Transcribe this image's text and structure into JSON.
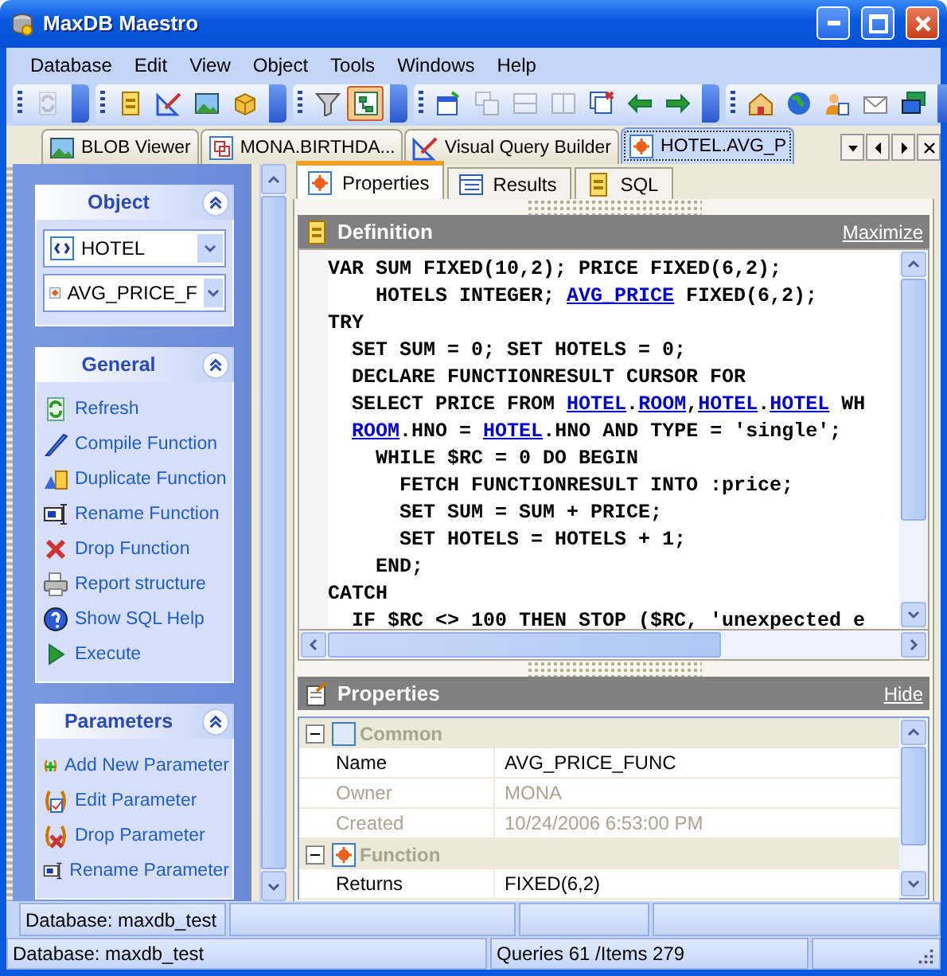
{
  "window": {
    "title": "MaxDB Maestro"
  },
  "menu": [
    {
      "label": "Database"
    },
    {
      "label": "Edit"
    },
    {
      "label": "View"
    },
    {
      "label": "Object"
    },
    {
      "label": "Tools"
    },
    {
      "label": "Windows"
    },
    {
      "label": "Help"
    }
  ],
  "toolbar": [
    {
      "buttons": [
        {
          "disabled": true,
          "pressed": false
        }
      ]
    },
    {
      "buttons": [
        {
          "disabled": false,
          "pressed": false
        },
        {
          "disabled": false,
          "pressed": false
        },
        {
          "disabled": false,
          "pressed": false
        },
        {
          "disabled": false,
          "pressed": false
        }
      ]
    },
    {
      "buttons": [
        {
          "disabled": false,
          "pressed": false
        },
        {
          "disabled": false,
          "pressed": true
        }
      ]
    },
    {
      "buttons": [
        {
          "disabled": false,
          "pressed": false
        },
        {
          "disabled": true,
          "pressed": false
        },
        {
          "disabled": true,
          "pressed": false
        },
        {
          "disabled": true,
          "pressed": false
        },
        {
          "disabled": false,
          "pressed": false
        },
        {
          "disabled": false,
          "pressed": false
        },
        {
          "disabled": false,
          "pressed": false
        }
      ]
    },
    {
      "buttons": [
        {
          "disabled": false,
          "pressed": false
        },
        {
          "disabled": false,
          "pressed": false
        },
        {
          "disabled": false,
          "pressed": false
        },
        {
          "disabled": false,
          "pressed": false
        },
        {
          "disabled": false,
          "pressed": false
        }
      ]
    }
  ],
  "doc_tabs": [
    {
      "label": "BLOB Viewer",
      "selected": false
    },
    {
      "label": "MONA.BIRTHDA...",
      "selected": false
    },
    {
      "label": "Visual Query Builder",
      "selected": false
    },
    {
      "label": "HOTEL.AVG_P",
      "selected": true
    }
  ],
  "sidebar": {
    "groups": [
      {
        "title": "Object",
        "combos": [
          {
            "value": "HOTEL"
          },
          {
            "value": "AVG_PRICE_F"
          }
        ]
      },
      {
        "title": "General",
        "items": [
          {
            "label": "Refresh"
          },
          {
            "label": "Compile Function"
          },
          {
            "label": "Duplicate Function"
          },
          {
            "label": "Rename Function"
          },
          {
            "label": "Drop Function"
          },
          {
            "label": "Report structure"
          },
          {
            "label": "Show SQL Help"
          },
          {
            "label": "Execute"
          }
        ]
      },
      {
        "title": "Parameters",
        "items": [
          {
            "label": "Add New Parameter"
          },
          {
            "label": "Edit Parameter"
          },
          {
            "label": "Drop Parameter"
          },
          {
            "label": "Rename Parameter"
          }
        ]
      }
    ]
  },
  "sub_tabs": [
    {
      "label": "Properties",
      "selected": true
    },
    {
      "label": "Results",
      "selected": false
    },
    {
      "label": "SQL",
      "selected": false
    }
  ],
  "definition": {
    "title": "Definition",
    "link": "Maximize",
    "code": [
      [
        {
          "text": "VAR SUM FIXED(10,2); PRICE FIXED(6,2);",
          "link": false
        }
      ],
      [
        {
          "text": "    HOTELS INTEGER; ",
          "link": false
        },
        {
          "text": "AVG_PRICE",
          "link": true
        },
        {
          "text": " FIXED(6,2);",
          "link": false
        }
      ],
      [
        {
          "text": "TRY",
          "link": false
        }
      ],
      [
        {
          "text": "  SET SUM = 0; SET HOTELS = 0;",
          "link": false
        }
      ],
      [
        {
          "text": "  DECLARE FUNCTIONRESULT CURSOR FOR",
          "link": false
        }
      ],
      [
        {
          "text": "  SELECT PRICE FROM ",
          "link": false
        },
        {
          "text": "HOTEL",
          "link": true
        },
        {
          "text": ".",
          "link": false
        },
        {
          "text": "ROOM",
          "link": true
        },
        {
          "text": ",",
          "link": false
        },
        {
          "text": "HOTEL",
          "link": true
        },
        {
          "text": ".",
          "link": false
        },
        {
          "text": "HOTEL",
          "link": true
        },
        {
          "text": " WH",
          "link": false
        }
      ],
      [
        {
          "text": "  ROOM",
          "link": true
        },
        {
          "text": ".HNO = ",
          "link": false
        },
        {
          "text": "HOTEL",
          "link": true
        },
        {
          "text": ".HNO AND TYPE = 'single';",
          "link": false
        }
      ],
      [
        {
          "text": "    WHILE $RC = 0 DO BEGIN",
          "link": false
        }
      ],
      [
        {
          "text": "      FETCH FUNCTIONRESULT INTO :price;",
          "link": false
        }
      ],
      [
        {
          "text": "      SET SUM = SUM + PRICE;",
          "link": false
        }
      ],
      [
        {
          "text": "      SET HOTELS = HOTELS + 1;",
          "link": false
        }
      ],
      [
        {
          "text": "    END;",
          "link": false
        }
      ],
      [
        {
          "text": "CATCH",
          "link": false
        }
      ],
      [
        {
          "text": "  IF $RC <> 100 THEN STOP ($RC, 'unexpected e",
          "link": false
        }
      ]
    ]
  },
  "properties": {
    "title": "Properties",
    "link": "Hide",
    "categories": [
      {
        "label": "Common",
        "expanded": true,
        "rows": [
          {
            "name": "Name",
            "value": "AVG_PRICE_FUNC",
            "disabled": false
          },
          {
            "name": "Owner",
            "value": "MONA",
            "disabled": true
          },
          {
            "name": "Created",
            "value": "10/24/2006 6:53:00 PM",
            "disabled": true
          }
        ]
      },
      {
        "label": "Function",
        "expanded": true,
        "rows": [
          {
            "name": "Returns",
            "value": "FIXED(6,2)",
            "disabled": false
          }
        ]
      }
    ]
  },
  "inner_status_bar": {
    "database": "Database: maxdb_test"
  },
  "status_bar": {
    "database": "Database: maxdb_test",
    "counts": "Queries 61 /Items 279"
  }
}
